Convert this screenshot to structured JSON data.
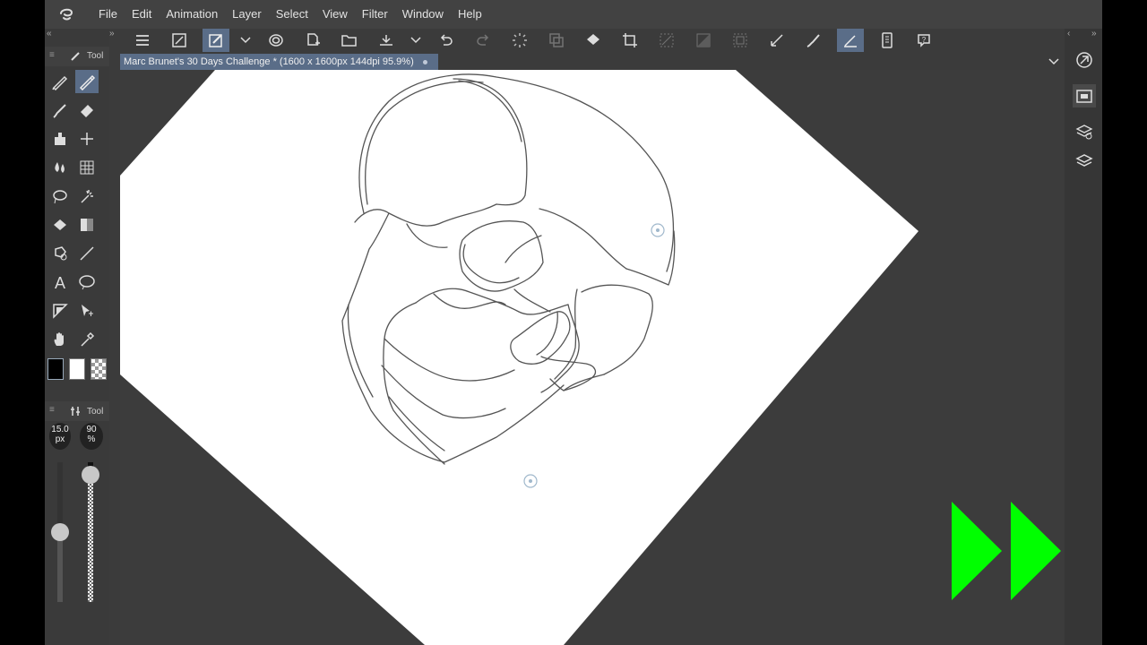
{
  "menu": [
    "File",
    "Edit",
    "Animation",
    "Layer",
    "Select",
    "View",
    "Filter",
    "Window",
    "Help"
  ],
  "document_tab": {
    "title": "Marc Brunet's 30 Days Challenge * (1600 x 1600px 144dpi 95.9%)"
  },
  "tool_panel": {
    "title": "Tool"
  },
  "sub_tool_panel": {
    "title": "Tool"
  },
  "brush": {
    "size_value": "15.0",
    "size_unit": "px",
    "opacity_value": "90",
    "opacity_unit": "%"
  },
  "sliders": {
    "brush_size_level": 0.5,
    "opacity_level": 0.9
  },
  "colors": {
    "accent": "#5a6d88",
    "panel": "#3a3a3a",
    "canvas_bg": "#ffffff",
    "fast_forward": "#00ff00"
  }
}
